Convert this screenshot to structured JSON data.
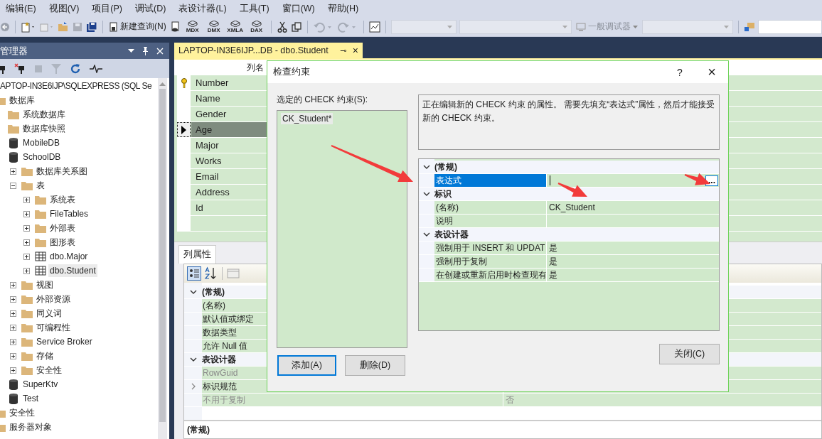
{
  "menu": [
    "编辑(E)",
    "视图(V)",
    "项目(P)",
    "调试(D)",
    "表设计器(L)",
    "工具(T)",
    "窗口(W)",
    "帮助(H)"
  ],
  "toolbar": {
    "new_query": "新建查询(N)",
    "script_labels": [
      "MDX",
      "DMX",
      "XMLA",
      "DAX"
    ],
    "debugger": "一般调试器"
  },
  "explorer": {
    "title": "管理器",
    "tree": [
      {
        "label": "APTOP-IN3E6IJP\\SQLEXPRESS (SQL Se",
        "kind": "server",
        "selected": false,
        "children": [
          {
            "label": "数据库",
            "kind": "folder",
            "selected": false,
            "children": [
              {
                "label": "系统数据库",
                "kind": "folder",
                "selected": false
              },
              {
                "label": "数据库快照",
                "kind": "folder",
                "selected": false
              },
              {
                "label": "MobileDB",
                "kind": "database",
                "selected": false
              },
              {
                "label": "SchoolDB",
                "kind": "database",
                "selected": false,
                "children": [
                  {
                    "label": "数据库关系图",
                    "kind": "folder",
                    "expanded": false,
                    "selected": false
                  },
                  {
                    "label": "表",
                    "kind": "folder",
                    "expanded": true,
                    "selected": false,
                    "children": [
                      {
                        "label": "系统表",
                        "kind": "folder",
                        "expanded": false,
                        "selected": false
                      },
                      {
                        "label": "FileTables",
                        "kind": "folder",
                        "expanded": false,
                        "selected": false
                      },
                      {
                        "label": "外部表",
                        "kind": "folder",
                        "expanded": false,
                        "selected": false
                      },
                      {
                        "label": "图形表",
                        "kind": "folder",
                        "expanded": false,
                        "selected": false
                      },
                      {
                        "label": "dbo.Major",
                        "kind": "table",
                        "expanded": false,
                        "selected": false
                      },
                      {
                        "label": "dbo.Student",
                        "kind": "table",
                        "expanded": false,
                        "selected": true
                      }
                    ]
                  },
                  {
                    "label": "视图",
                    "kind": "folder",
                    "expanded": false,
                    "selected": false
                  },
                  {
                    "label": "外部资源",
                    "kind": "folder",
                    "expanded": false,
                    "selected": false
                  },
                  {
                    "label": "同义词",
                    "kind": "folder",
                    "expanded": false,
                    "selected": false
                  },
                  {
                    "label": "可编程性",
                    "kind": "folder",
                    "expanded": false,
                    "selected": false
                  },
                  {
                    "label": "Service Broker",
                    "kind": "folder",
                    "expanded": false,
                    "selected": false
                  },
                  {
                    "label": "存储",
                    "kind": "folder",
                    "expanded": false,
                    "selected": false
                  },
                  {
                    "label": "安全性",
                    "kind": "folder",
                    "expanded": false,
                    "selected": false
                  }
                ]
              },
              {
                "label": "SuperKtv",
                "kind": "database",
                "selected": false
              },
              {
                "label": "Test",
                "kind": "database",
                "selected": false
              }
            ]
          },
          {
            "label": "安全性",
            "kind": "folder",
            "selected": false
          },
          {
            "label": "服务器对象",
            "kind": "folder",
            "selected": false
          }
        ]
      }
    ]
  },
  "document_tab": {
    "title": "LAPTOP-IN3E6IJP...DB - dbo.Student",
    "pin": "⊸",
    "close": "×"
  },
  "columns_grid": {
    "header": "列名",
    "rows": [
      {
        "name": "Number",
        "primary_key": true,
        "selected": false
      },
      {
        "name": "Name",
        "primary_key": false,
        "selected": false
      },
      {
        "name": "Gender",
        "primary_key": false,
        "selected": false
      },
      {
        "name": "Age",
        "primary_key": false,
        "selected": true
      },
      {
        "name": "Major",
        "primary_key": false,
        "selected": false
      },
      {
        "name": "Works",
        "primary_key": false,
        "selected": false
      },
      {
        "name": "Email",
        "primary_key": false,
        "selected": false
      },
      {
        "name": "Address",
        "primary_key": false,
        "selected": false
      },
      {
        "name": "Id",
        "primary_key": false,
        "selected": false
      }
    ]
  },
  "properties_panel": {
    "tab": "列属性",
    "groups": [
      {
        "title": "(常规)",
        "expanded": true,
        "rows": [
          {
            "name": "(名称)",
            "kind": "plain",
            "disabled": false
          },
          {
            "name": "默认值或绑定",
            "kind": "plain",
            "disabled": false
          },
          {
            "name": "数据类型",
            "kind": "plain",
            "disabled": false
          },
          {
            "name": "允许 Null 值",
            "kind": "plain",
            "disabled": false
          }
        ]
      },
      {
        "title": "表设计器",
        "expanded": true,
        "rows": [
          {
            "name": "RowGuid",
            "kind": "plain",
            "disabled": true
          },
          {
            "name": "标识规范",
            "kind": "expander",
            "disabled": false
          },
          {
            "name": "不用于复制",
            "kind": "plain",
            "disabled": true,
            "value": "否"
          }
        ]
      }
    ],
    "description": "(常规)"
  },
  "dialog": {
    "title": "检查约束",
    "help": "?",
    "close": "×",
    "list_label": "选定的 CHECK 约束(S):",
    "constraints": [
      {
        "name": "CK_Student*",
        "selected": true
      }
    ],
    "description": "正在编辑新的 CHECK 约束 的属性。  需要先填充“表达式”属性，然后才能接受新的 CHECK 约束。",
    "groups": [
      {
        "title": "(常规)",
        "expanded": true,
        "rows": [
          {
            "name": "表达式",
            "selected": true,
            "button": "..."
          }
        ]
      },
      {
        "title": "标识",
        "expanded": true,
        "rows": [
          {
            "name": "(名称)",
            "selected": false,
            "value": "CK_Student"
          },
          {
            "name": "说明",
            "selected": false
          }
        ]
      },
      {
        "title": "表设计器",
        "expanded": true,
        "rows": [
          {
            "name": "强制用于 INSERT 和 UPDAT",
            "selected": false,
            "value": "是"
          },
          {
            "name": "强制用于复制",
            "selected": false,
            "value": "是"
          },
          {
            "name": "在创建或重新启用时检查现有",
            "selected": false,
            "value": "是"
          }
        ]
      }
    ],
    "buttons": [
      {
        "label": "添加(A)",
        "focused": true
      },
      {
        "label": "删除(D)",
        "focused": false
      }
    ],
    "close_button": "关闭(C)"
  }
}
